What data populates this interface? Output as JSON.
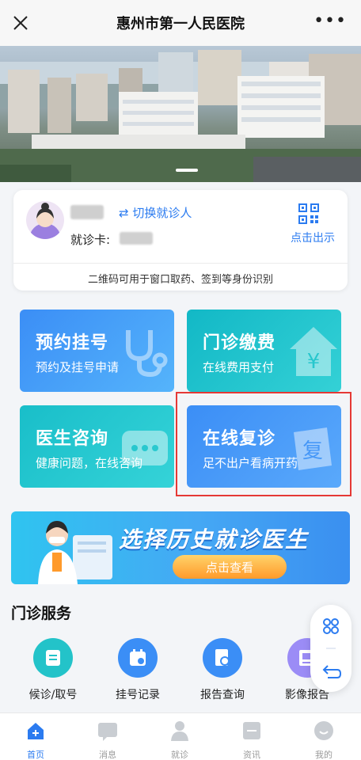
{
  "header": {
    "title": "惠州市第一人民医院"
  },
  "patient_card": {
    "switch_label": "⇄ 切换就诊人",
    "card_label": "就诊卡:",
    "qr_label": "点击出示",
    "note": "二维码可用于窗口取药、签到等身份识别"
  },
  "tiles": [
    {
      "title": "预约挂号",
      "subtitle": "预约及挂号申请"
    },
    {
      "title": "门诊缴费",
      "subtitle": "在线费用支付",
      "deco": "¥"
    },
    {
      "title": "医生咨询",
      "subtitle": "健康问题，在线咨询"
    },
    {
      "title": "在线复诊",
      "subtitle": "足不出户看病开药",
      "deco": "复"
    }
  ],
  "promo": {
    "title": "选择历史就诊医生",
    "button": "点击查看"
  },
  "outpatient": {
    "title": "门诊服务",
    "items": [
      {
        "label": "候诊/取号",
        "icon": "ticket-icon",
        "color": "#23c3c9"
      },
      {
        "label": "挂号记录",
        "icon": "calendar-icon",
        "color": "#3b8ef6"
      },
      {
        "label": "报告查询",
        "icon": "report-search-icon",
        "color": "#3b8ef6"
      },
      {
        "label": "影像报告",
        "icon": "image-report-icon",
        "color": "#9b8cf6"
      }
    ]
  },
  "tabbar": [
    {
      "label": "首页",
      "icon": "home-icon",
      "active": true
    },
    {
      "label": "消息",
      "icon": "message-icon",
      "active": false
    },
    {
      "label": "就诊",
      "icon": "doctor-icon",
      "active": false
    },
    {
      "label": "资讯",
      "icon": "news-icon",
      "active": false
    },
    {
      "label": "我的",
      "icon": "profile-icon",
      "active": false
    }
  ],
  "colors": {
    "accent": "#2b7bf0",
    "teal": "#23c3c9",
    "highlight_border": "#e53935"
  }
}
